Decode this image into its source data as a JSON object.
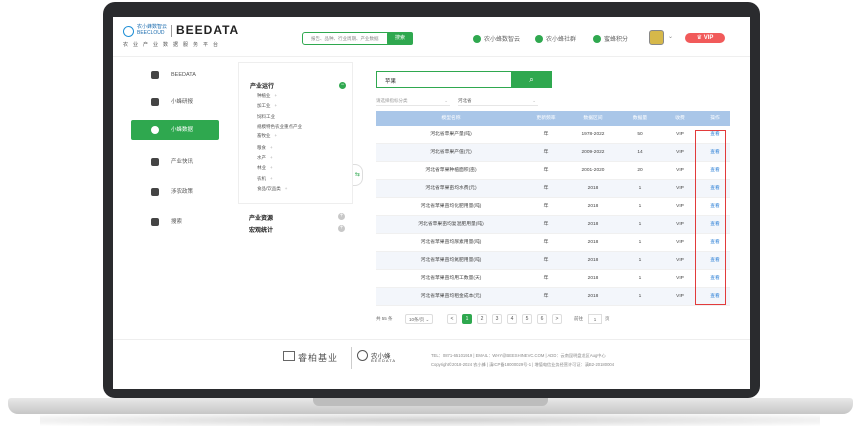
{
  "header": {
    "logo_small": "农小蜂数智云 BEECLOUD",
    "logo_big": "BEEDATA",
    "logo_tagline": "农业产业数据服务平台",
    "search_placeholder": "报告、品种、行业周期、产业数据",
    "search_button": "搜索",
    "nav_links": [
      {
        "label": "农小蜂数智云",
        "icon": "cloud-icon",
        "color": "#2fa84f"
      },
      {
        "label": "农小蜂社群",
        "icon": "community-icon",
        "color": "#2fa84f"
      },
      {
        "label": "蜜蜂积分",
        "icon": "points-icon",
        "color": "#2fa84f"
      }
    ],
    "vip_label": "VIP"
  },
  "sidebar": {
    "items": [
      {
        "label": "BEEDATA",
        "icon": "home-icon",
        "active": false
      },
      {
        "label": "小蜂研报",
        "icon": "report-icon",
        "active": false
      },
      {
        "label": "小蜂数据",
        "icon": "cloud-data-icon",
        "active": true
      },
      {
        "label": "产业快讯",
        "icon": "news-icon",
        "active": false
      },
      {
        "label": "涉农政策",
        "icon": "policy-icon",
        "active": false
      },
      {
        "label": "搜索",
        "icon": "search-icon",
        "active": false
      }
    ]
  },
  "tree": {
    "sections": [
      {
        "label": "产业运行",
        "expanded": true
      },
      {
        "label": "产业资源",
        "expanded": false
      },
      {
        "label": "宏观统计",
        "expanded": false
      }
    ],
    "items": [
      {
        "label": "种植业",
        "has_plus": true
      },
      {
        "label": "加工业",
        "has_plus": true
      },
      {
        "label": "饲料工业",
        "has_plus": false
      },
      {
        "label": "规模特色农业重点产业",
        "has_plus": false
      },
      {
        "label": "畜牧业",
        "has_plus": true
      },
      {
        "label": "粮食",
        "has_plus": true
      },
      {
        "label": "水产",
        "has_plus": true
      },
      {
        "label": "林业",
        "has_plus": true
      },
      {
        "label": "农机",
        "has_plus": true
      },
      {
        "label": "食品/饮品类",
        "has_plus": true
      }
    ]
  },
  "query": {
    "value": "苹果",
    "search_icon": "search-icon"
  },
  "filters": [
    {
      "placeholder": "请选择指标分类"
    },
    {
      "value": "河北省"
    }
  ],
  "table": {
    "headers": [
      "模型名称",
      "更新频率",
      "数据区间",
      "数据量",
      "收费",
      "操作"
    ],
    "rows": [
      {
        "name": "河北省苹果产量(吨)",
        "freq": "年",
        "range": "1978-2022",
        "count": "50",
        "fee": "VIP",
        "action": "查看"
      },
      {
        "name": "河北省苹果产值(元)",
        "freq": "年",
        "range": "2009-2022",
        "count": "14",
        "fee": "VIP",
        "action": "查看"
      },
      {
        "name": "河北省苹果种植面积(亩)",
        "freq": "年",
        "range": "2001-2020",
        "count": "20",
        "fee": "VIP",
        "action": "查看"
      },
      {
        "name": "河北省苹果亩均水费(元)",
        "freq": "年",
        "range": "2018",
        "count": "1",
        "fee": "VIP",
        "action": "查看"
      },
      {
        "name": "河北省苹果亩均化肥用量(吨)",
        "freq": "年",
        "range": "2018",
        "count": "1",
        "fee": "VIP",
        "action": "查看"
      },
      {
        "name": "河北省苹果亩均复混肥用量(吨)",
        "freq": "年",
        "range": "2018",
        "count": "1",
        "fee": "VIP",
        "action": "查看"
      },
      {
        "name": "河北省苹果亩均尿素用量(吨)",
        "freq": "年",
        "range": "2018",
        "count": "1",
        "fee": "VIP",
        "action": "查看"
      },
      {
        "name": "河北省苹果亩均氮肥用量(吨)",
        "freq": "年",
        "range": "2018",
        "count": "1",
        "fee": "VIP",
        "action": "查看"
      },
      {
        "name": "河北省苹果亩均用工数量(天)",
        "freq": "年",
        "range": "2018",
        "count": "1",
        "fee": "VIP",
        "action": "查看"
      },
      {
        "name": "河北省苹果亩均租金成本(元)",
        "freq": "年",
        "range": "2018",
        "count": "1",
        "fee": "VIP",
        "action": "查看"
      }
    ]
  },
  "pagination": {
    "total": "共 55 条",
    "page_size": "10条/页",
    "prev": "<",
    "pages": [
      "1",
      "2",
      "3",
      "4",
      "5",
      "6"
    ],
    "current": "1",
    "next": ">",
    "goto_label": "前往",
    "goto_value": "1",
    "goto_suffix": "页"
  },
  "footer": {
    "brand1": "睿柏基业",
    "brand2": "农小蜂",
    "brand2_sub": "BEEDATA",
    "line1": "TEL：0871-65101919 | EMAIL：WHY@BEESHINEVC.COM | ADD：云南昆明盘龙区Aug中心",
    "line2": "Copyright©2018-2024 农小蜂 | 滇ICP备18000029号-1 | 增值电信业务经营许可证：滇B2-20180004"
  }
}
